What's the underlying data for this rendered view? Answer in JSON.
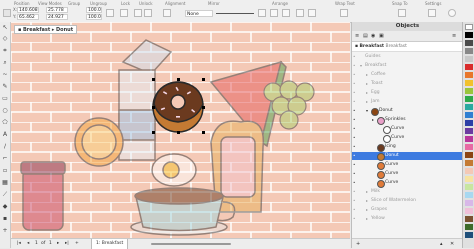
{
  "propbar": {
    "groups": [
      "Position",
      "View Modes",
      "Group",
      "Ungroup",
      "Lock",
      "Unlock",
      "Alignment",
      "Mirror",
      "Arrange",
      "Wrap Text",
      "Snap To",
      "Settings"
    ],
    "x_value": "140.608",
    "y_value": "65.462",
    "w_value": "25.778",
    "h_value": "24.927",
    "scale_x": "100.0",
    "scale_y": "100.0",
    "outline_value": "None"
  },
  "breadcrumb": {
    "root": "Breakfast",
    "current": "Donut"
  },
  "objects": {
    "title": "Objects",
    "doc_label": "Breakfast",
    "doc_sub": "Breakfast",
    "rows": [
      {
        "label": "Guides",
        "level": 0,
        "arrow": "",
        "thumb": "",
        "faded": true
      },
      {
        "label": "Breakfast",
        "level": 0,
        "arrow": "▾",
        "thumb": "",
        "faded": true
      },
      {
        "label": "Coffee",
        "level": 1,
        "arrow": "▸",
        "thumb": "",
        "faded": true
      },
      {
        "label": "Toast",
        "level": 1,
        "arrow": "▸",
        "thumb": "",
        "faded": true
      },
      {
        "label": "Egg",
        "level": 1,
        "arrow": "▸",
        "thumb": "",
        "faded": true
      },
      {
        "label": "Jam",
        "level": 1,
        "arrow": "▸",
        "thumb": "",
        "faded": true
      },
      {
        "label": "Donut",
        "level": 1,
        "arrow": "▾",
        "thumb": "#8b4513",
        "faded": false
      },
      {
        "label": "Sprinkles",
        "level": 2,
        "arrow": "▸",
        "thumb": "#e8a0c8",
        "faded": false
      },
      {
        "label": "Curve",
        "level": 3,
        "arrow": "",
        "thumb": "#ffffff",
        "faded": false
      },
      {
        "label": "Curve",
        "level": 3,
        "arrow": "",
        "thumb": "#ffffff",
        "faded": false
      },
      {
        "label": "Icing",
        "level": 2,
        "arrow": "",
        "thumb": "#6b3a1f",
        "faded": false
      },
      {
        "label": "Donut",
        "level": 2,
        "arrow": "",
        "thumb": "#c47a33",
        "faded": false,
        "selected": true
      },
      {
        "label": "Curve",
        "level": 2,
        "arrow": "",
        "thumb": "#e07b39",
        "faded": false
      },
      {
        "label": "Curve",
        "level": 2,
        "arrow": "",
        "thumb": "#e07b39",
        "faded": false
      },
      {
        "label": "Curve",
        "level": 2,
        "arrow": "",
        "thumb": "#e07b39",
        "faded": false
      },
      {
        "label": "Milk",
        "level": 1,
        "arrow": "▸",
        "thumb": "",
        "faded": true
      },
      {
        "label": "Slice of Watermelon",
        "level": 1,
        "arrow": "▸",
        "thumb": "",
        "faded": true
      },
      {
        "label": "Grapes",
        "level": 1,
        "arrow": "▸",
        "thumb": "",
        "faded": true
      },
      {
        "label": "Yellow",
        "level": 1,
        "arrow": "▸",
        "thumb": "",
        "faded": true
      }
    ]
  },
  "bottombar": {
    "page_label": "1",
    "of_label": "of",
    "page_total": "1",
    "page_tab": "1: Breakfast"
  },
  "colors": {
    "brick": "#f4c9b6",
    "brick_line": "#ffffff",
    "donut": "#c47a33",
    "icing": "#6b3a1f",
    "selection": "#3d7be0"
  }
}
